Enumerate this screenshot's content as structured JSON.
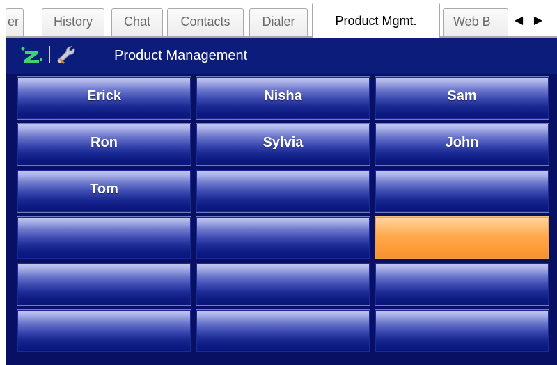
{
  "tabs": [
    {
      "label": "er",
      "active": false
    },
    {
      "label": "History",
      "active": false
    },
    {
      "label": "Chat",
      "active": false
    },
    {
      "label": "Contacts",
      "active": false
    },
    {
      "label": "Dialer",
      "active": false
    },
    {
      "label": "Product Mgmt.",
      "active": true
    },
    {
      "label": "Web B",
      "active": false
    }
  ],
  "tab_scroll": {
    "left_glyph": "◀",
    "right_glyph": "▶"
  },
  "header": {
    "title": "Product Management",
    "icons": [
      "z-logo-icon",
      "wrench-icon"
    ]
  },
  "tiles": [
    {
      "label": "Erick",
      "state": "normal"
    },
    {
      "label": "Nisha",
      "state": "normal"
    },
    {
      "label": "Sam",
      "state": "normal"
    },
    {
      "label": "Ron",
      "state": "normal"
    },
    {
      "label": "Sylvia",
      "state": "normal"
    },
    {
      "label": "John",
      "state": "normal"
    },
    {
      "label": "Tom",
      "state": "normal"
    },
    {
      "label": "",
      "state": "normal"
    },
    {
      "label": "",
      "state": "normal"
    },
    {
      "label": "",
      "state": "normal"
    },
    {
      "label": "",
      "state": "normal"
    },
    {
      "label": "",
      "state": "highlighted"
    },
    {
      "label": "",
      "state": "normal"
    },
    {
      "label": "",
      "state": "normal"
    },
    {
      "label": "",
      "state": "normal"
    },
    {
      "label": "",
      "state": "normal"
    },
    {
      "label": "",
      "state": "normal"
    },
    {
      "label": "",
      "state": "normal"
    }
  ],
  "colors": {
    "panel_background": "#071063",
    "tile_blue": "#1b2a93",
    "tile_highlight": "#ff9f3c",
    "z_logo_green": "#3fd36a"
  }
}
